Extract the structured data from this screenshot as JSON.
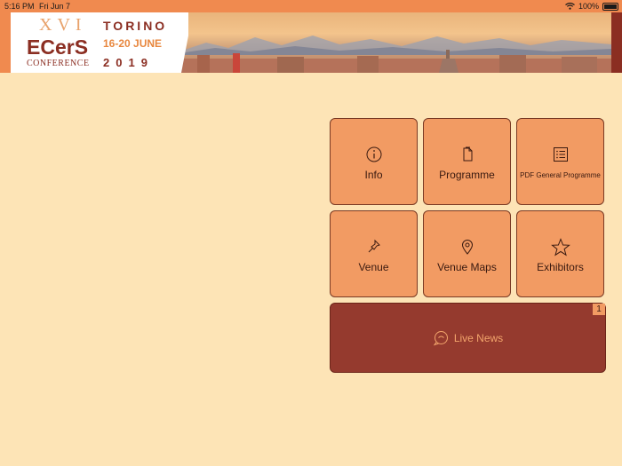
{
  "status": {
    "time": "5:16 PM",
    "date": "Fri Jun 7",
    "battery": "100%"
  },
  "banner": {
    "roman": "XVI",
    "brand": "ECerS",
    "conference": "CONFERENCE",
    "city": "TORINO",
    "dates": "16-20 JUNE",
    "year": "2019"
  },
  "tiles": [
    {
      "label": "Info",
      "icon": "info-icon"
    },
    {
      "label": "Programme",
      "icon": "document-icon"
    },
    {
      "label": "PDF General Programme",
      "icon": "list-icon"
    },
    {
      "label": "Venue",
      "icon": "pin-icon"
    },
    {
      "label": "Venue Maps",
      "icon": "map-marker-icon"
    },
    {
      "label": "Exhibitors",
      "icon": "star-icon"
    }
  ],
  "news": {
    "label": "Live News",
    "badge": "1",
    "icon": "chat-icon"
  },
  "colors": {
    "background": "#fde4b6",
    "accent": "#f08a4f",
    "tile": "#f29b63",
    "news": "#953a2e"
  }
}
